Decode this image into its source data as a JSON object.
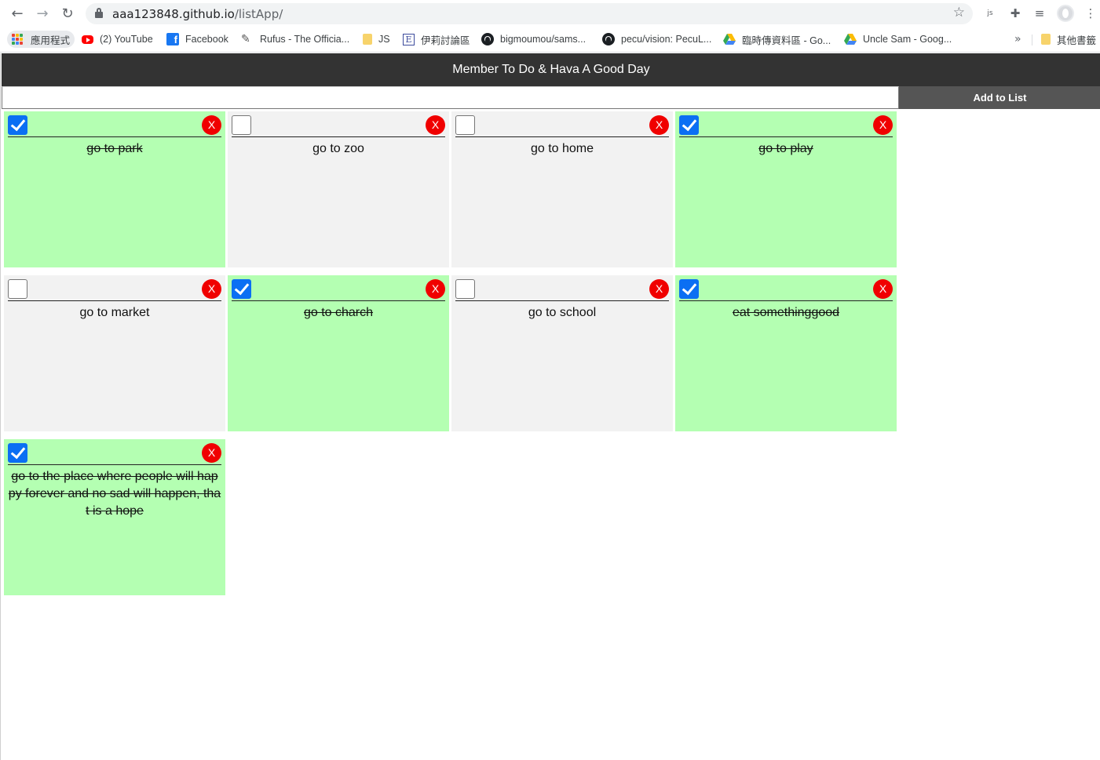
{
  "browser": {
    "url_host": "aaa123848.github.io",
    "url_path": "/listApp/",
    "nav_back": "←",
    "nav_forward": "→",
    "nav_reload": "↻",
    "star": "☆",
    "ext_js": "js",
    "ext_puzzle": "✚",
    "ext_queue": "≡",
    "menu": "⋮",
    "bookmarks_more": "»",
    "bookmarks": [
      {
        "label": "應用程式",
        "icon": "apps-grid-icon"
      },
      {
        "label": "(2) YouTube",
        "icon": "youtube-icon"
      },
      {
        "label": "Facebook",
        "icon": "facebook-icon",
        "glyph": "f"
      },
      {
        "label": "Rufus - The Officia...",
        "icon": "rufus-icon",
        "glyph": "✎"
      },
      {
        "label": "JS",
        "icon": "folder-icon"
      },
      {
        "label": "伊莉討論區",
        "icon": "eyny-icon",
        "glyph": "E"
      },
      {
        "label": "bigmoumou/sams...",
        "icon": "github-icon"
      },
      {
        "label": "pecu/vision: PecuL...",
        "icon": "github-icon"
      },
      {
        "label": "臨時傳資料區 - Go...",
        "icon": "google-drive-icon"
      },
      {
        "label": "Uncle Sam - Goog...",
        "icon": "google-drive-icon"
      },
      {
        "label": "其他書籤",
        "icon": "folder-icon"
      }
    ]
  },
  "app": {
    "title": "Member To Do & Hava A Good Day",
    "input_value": "",
    "add_button": "Add to List",
    "delete_label": "X",
    "colors": {
      "done": "#b4ffb2",
      "pending": "#f2f2f2",
      "header": "#333333",
      "delete": "#f00000",
      "check": "#0b6ff3"
    },
    "items": [
      {
        "text": "go to park",
        "done": true
      },
      {
        "text": "go to zoo",
        "done": false
      },
      {
        "text": "go to home",
        "done": false
      },
      {
        "text": "go to play",
        "done": true
      },
      {
        "text": "go to market",
        "done": false
      },
      {
        "text": "go to charch",
        "done": true
      },
      {
        "text": "go to school",
        "done": false
      },
      {
        "text": "eat somethinggood",
        "done": true
      },
      {
        "text": "go to the place where people will happy forever and no sad will happen, that is a hope",
        "done": true
      }
    ]
  }
}
